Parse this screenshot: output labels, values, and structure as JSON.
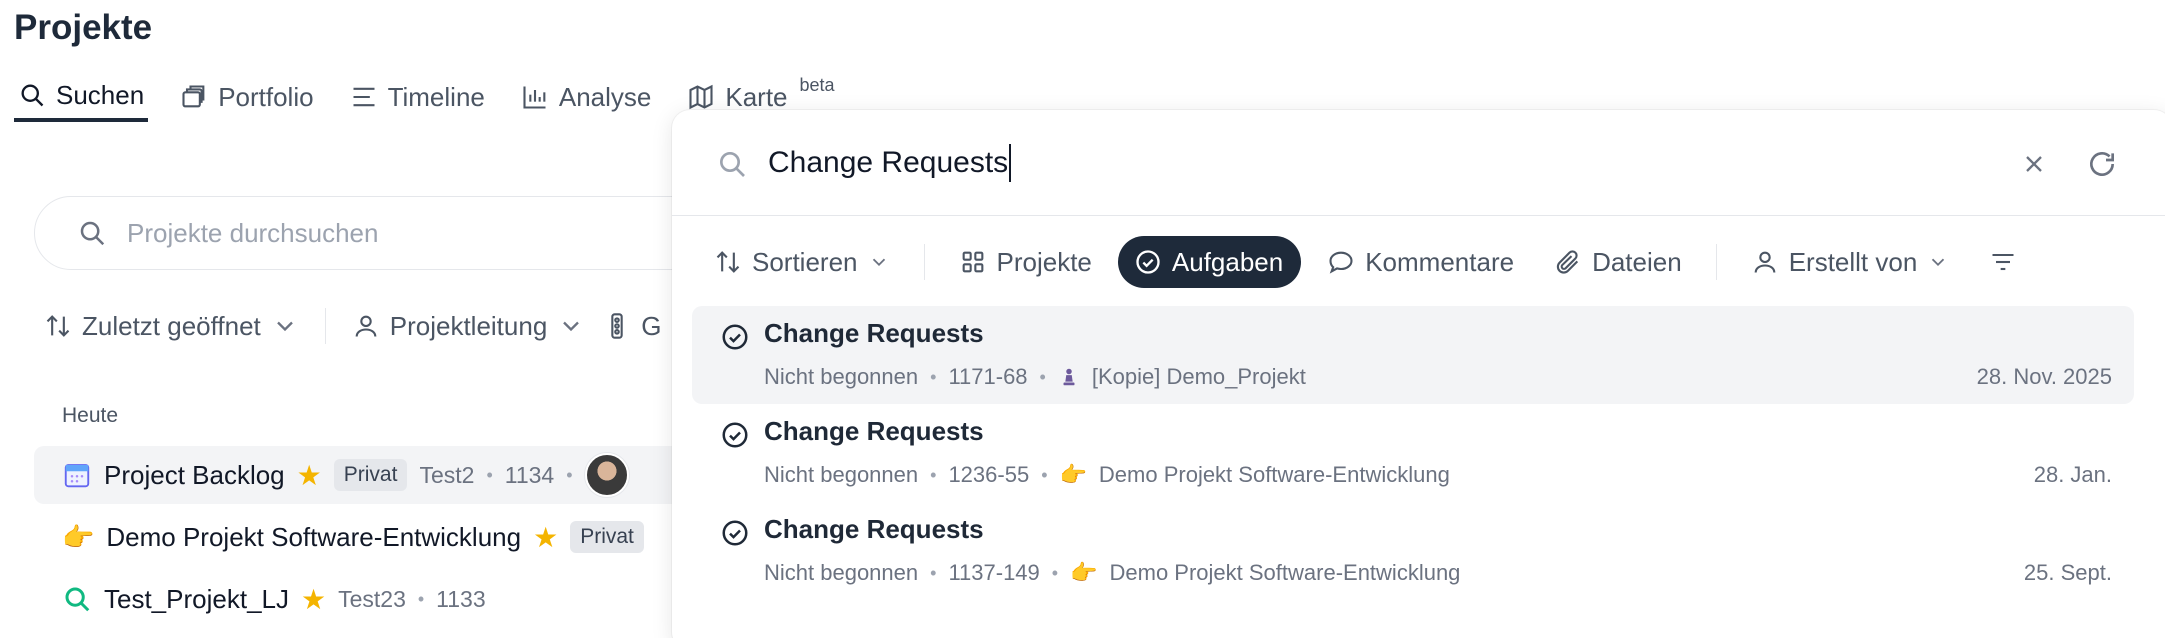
{
  "page": {
    "title": "Projekte"
  },
  "tabs": [
    {
      "label": "Suchen",
      "icon": "search-icon",
      "active": true
    },
    {
      "label": "Portfolio",
      "icon": "portfolio-icon"
    },
    {
      "label": "Timeline",
      "icon": "timeline-icon"
    },
    {
      "label": "Analyse",
      "icon": "chart-icon"
    },
    {
      "label": "Karte",
      "icon": "map-icon",
      "badge": "beta"
    }
  ],
  "background": {
    "search_placeholder": "Projekte durchsuchen",
    "filters": {
      "sort": "Zuletzt geöffnet",
      "lead": "Projektleitung",
      "third": "G"
    },
    "section": "Heute",
    "rows": [
      {
        "name": "Project Backlog",
        "badge": "Privat",
        "owner": "Test2",
        "id": "1134"
      },
      {
        "name": "Demo Projekt Software-Entwicklung",
        "badge": "Privat"
      },
      {
        "name": "Test_Projekt_LJ",
        "owner": "Test23",
        "id": "1133"
      }
    ]
  },
  "panel": {
    "query": "Change Requests",
    "chips": {
      "sort": "Sortieren",
      "projects": "Projekte",
      "tasks": "Aufgaben",
      "comments": "Kommentare",
      "files": "Dateien",
      "creator": "Erstellt von"
    },
    "results": [
      {
        "title": "Change Requests",
        "status": "Nicht begonnen",
        "number": "1171-68",
        "project": "[Kopie] Demo_Projekt",
        "date": "28. Nov. 2025"
      },
      {
        "title": "Change Requests",
        "status": "Nicht begonnen",
        "number": "1236-55",
        "project": "Demo Projekt Software-Entwicklung",
        "date": "28. Jan."
      },
      {
        "title": "Change Requests",
        "status": "Nicht begonnen",
        "number": "1137-149",
        "project": "Demo Projekt Software-Entwicklung",
        "date": "25. Sept."
      }
    ]
  },
  "colors": {
    "accent": "#1e2a3a",
    "star": "#f4b400",
    "highlight": "#f3f4f6"
  }
}
